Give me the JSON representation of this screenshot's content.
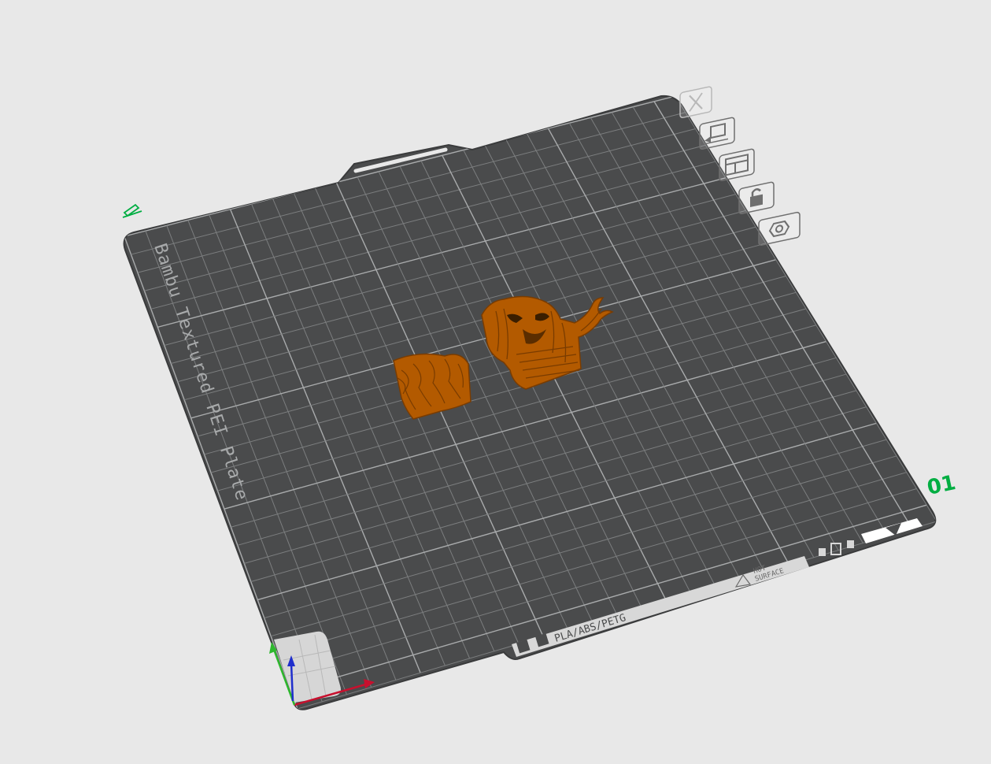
{
  "plate": {
    "name": "Bambu Textured PEI Plate",
    "number": "01",
    "material_label": "PLA/ABS/PETG",
    "warning_line1": "HOT",
    "warning_line2": "SURFACE"
  },
  "toolbar": {
    "items": [
      {
        "name": "close-plate-icon",
        "label": "Remove plate"
      },
      {
        "name": "auto-orient-icon",
        "label": "Auto orient"
      },
      {
        "name": "arrange-icon",
        "label": "Arrange"
      },
      {
        "name": "lock-icon",
        "label": "Lock plate"
      },
      {
        "name": "plate-settings-icon",
        "label": "Plate settings"
      }
    ]
  },
  "colors": {
    "background": "#e8e8e8",
    "plate": "#4a4b4c",
    "grid": "#8c8e8f",
    "model": "#b35a00",
    "model_dark": "#7a3c00",
    "accent_green": "#00ae42",
    "axis_x": "#c8102e",
    "axis_y": "#2eb82e",
    "axis_z": "#1f2ecc"
  }
}
